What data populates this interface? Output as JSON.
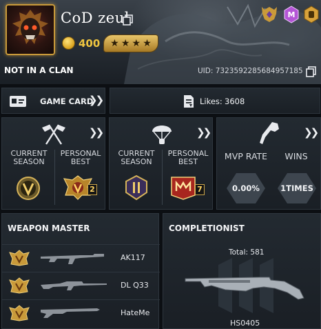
{
  "profile": {
    "username": "CoD zeul",
    "coins": "400",
    "clan_status": "NOT IN A CLAN",
    "uid": "UID: 7323592285684957185"
  },
  "header_icons": [
    "rank-emblem-icon",
    "mythic-badge-icon",
    "season-badge-icon"
  ],
  "game_card": {
    "label": "GAME CARD"
  },
  "likes": {
    "label": "Likes:",
    "count": "3608"
  },
  "stats_rank_mp": {
    "col1": "CURRENT\nSEASON",
    "col2": "PERSONAL\nBEST",
    "best_tier": "2"
  },
  "stats_rank_br": {
    "col1": "CURRENT\nSEASON",
    "col2": "PERSONAL\nBEST",
    "best_tier": "7"
  },
  "stats_mvp": {
    "col1": "MVP RATE",
    "col2": "WINS",
    "mvp_value": "0.00%",
    "wins_value": "1TIMES"
  },
  "weapon_master": {
    "title": "WEAPON MASTER",
    "weapons": [
      {
        "name": "AK117"
      },
      {
        "name": "DL Q33"
      },
      {
        "name": "HateMe"
      }
    ]
  },
  "completionist": {
    "title": "COMPLETIONIST",
    "total": "Total: 581",
    "weapon": "HS0405"
  },
  "colors": {
    "gold": "#c99a3a",
    "panel": "#1e242a",
    "coin": "#f0c640"
  }
}
